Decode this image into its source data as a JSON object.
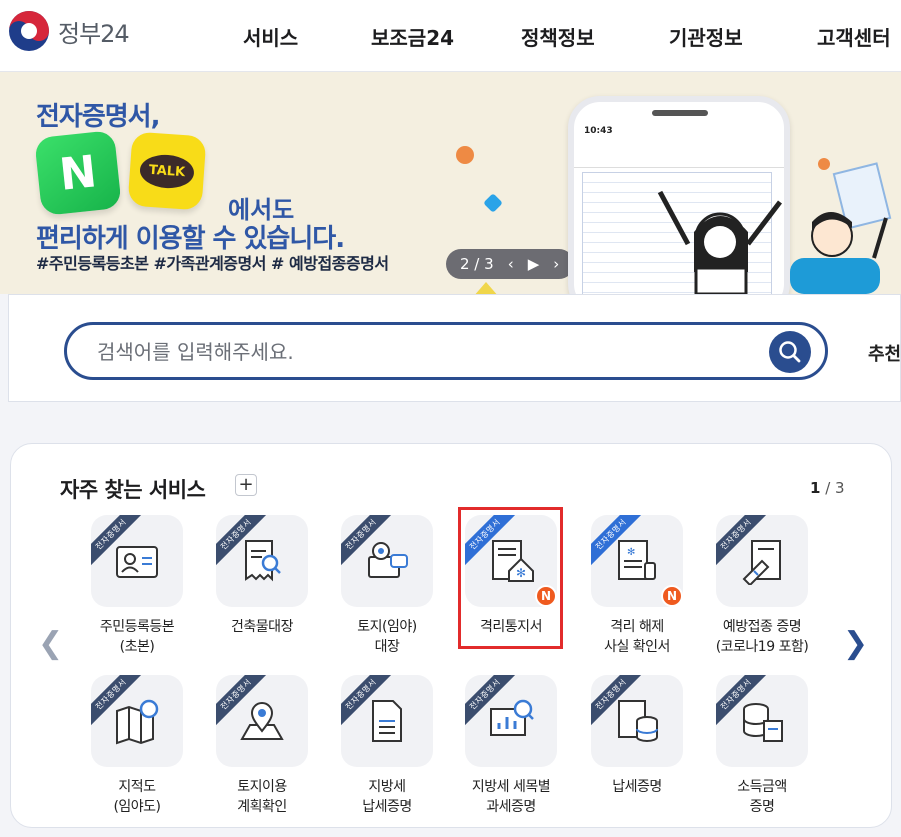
{
  "header": {
    "logo_text": "정부24",
    "nav": [
      "서비스",
      "보조금24",
      "정책정보",
      "기관정보",
      "고객센터"
    ]
  },
  "banner": {
    "line1": "전자증명서,",
    "naver_letter": "N",
    "kakao_label": "TALK",
    "line2": "에서도",
    "line3": "편리하게 이용할 수 있습니다.",
    "tags": "#주민등록등초본 #가족관계증명서 # 예방접종증명서",
    "pager_text": "2 / 3",
    "phone_time": "10:43"
  },
  "search": {
    "placeholder": "검색어를 입력해주세요.",
    "recommend_label": "추천"
  },
  "frequent": {
    "title": "자주 찾는 서비스",
    "plus": "+",
    "page_current": "1",
    "page_total": " / 3",
    "ribbon_text": "전자증명서",
    "badge_new": "N",
    "items": [
      {
        "label": "주민등록등본\n(초본)",
        "icon": "id-card-icon"
      },
      {
        "label": "건축물대장",
        "icon": "document-search-icon"
      },
      {
        "label": "토지(임야)\n대장",
        "icon": "land-map-icon"
      },
      {
        "label": "격리통지서",
        "icon": "quarantine-notice-icon",
        "new": true
      },
      {
        "label": "격리 해제\n사실 확인서",
        "icon": "quarantine-release-icon",
        "new": true
      },
      {
        "label": "예방접종 증명\n(코로나19 포함)",
        "icon": "vaccine-syringe-icon"
      },
      {
        "label": "지적도\n(임야도)",
        "icon": "cadastral-map-icon"
      },
      {
        "label": "토지이용\n계획확인",
        "icon": "map-pin-icon"
      },
      {
        "label": "지방세\n납세증명",
        "icon": "tax-document-icon"
      },
      {
        "label": "지방세 세목별\n과세증명",
        "icon": "chart-board-icon"
      },
      {
        "label": "납세증명",
        "icon": "coin-stack-document-icon"
      },
      {
        "label": "소득금액\n증명",
        "icon": "income-coins-icon"
      }
    ]
  },
  "colors": {
    "brand_navy": "#2a4d8f",
    "banner_bg": "#f4efe0",
    "ribbon_dark": "#3b4d6e",
    "ribbon_blue": "#2f6fd6",
    "badge_orange": "#ef5a1f",
    "highlight_red": "#e22b2b"
  }
}
